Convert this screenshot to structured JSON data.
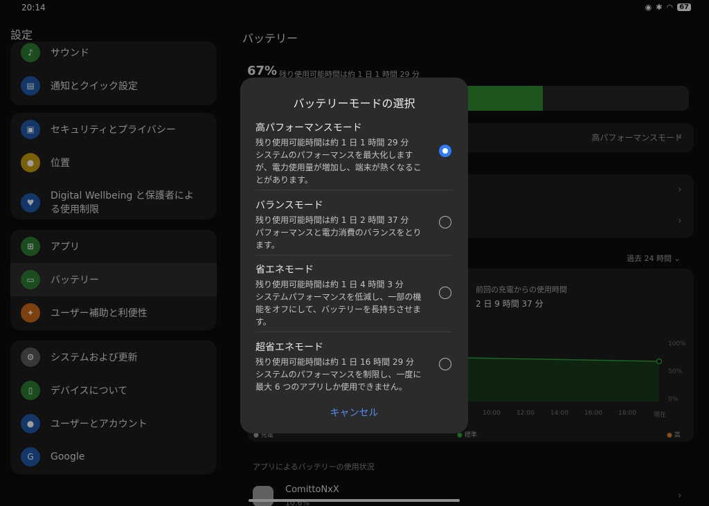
{
  "status": {
    "time": "20:14",
    "battery": "67"
  },
  "left": {
    "title": "設定",
    "group1": [
      {
        "label": "サウンド",
        "icon": "bell-icon"
      },
      {
        "label": "通知とクイック設定",
        "icon": "notification-icon"
      }
    ],
    "group2": [
      {
        "label": "セキュリティとプライバシー",
        "icon": "lock-icon"
      },
      {
        "label": "位置",
        "icon": "location-icon"
      },
      {
        "label": "Digital Wellbeing と保護者による使用制限",
        "icon": "wellbeing-icon"
      }
    ],
    "group3": [
      {
        "label": "アプリ",
        "icon": "apps-icon"
      },
      {
        "label": "バッテリー",
        "icon": "battery-icon"
      },
      {
        "label": "ユーザー補助と利便性",
        "icon": "accessibility-icon"
      }
    ],
    "group4": [
      {
        "label": "システムおよび更新",
        "icon": "gear-icon"
      },
      {
        "label": "デバイスについて",
        "icon": "device-icon"
      },
      {
        "label": "ユーザーとアカウント",
        "icon": "user-icon"
      },
      {
        "label": "Google",
        "icon": "google-icon"
      }
    ]
  },
  "right": {
    "title": "バッテリー",
    "percent": "67%",
    "remaining": "残り使用可能時間は約 1 日 1 時間 29 分",
    "fill_fraction": 0.67,
    "current_mode": "高パフォーマンスモード",
    "period": "過去 24 時間",
    "since_label": "前回の充電からの使用時間",
    "since_value": "2 日 9 時間 37 分",
    "y_ticks": [
      "100%",
      "50%",
      "0%"
    ],
    "x_ticks": [
      "10:00",
      "12:00",
      "14:00",
      "16:00",
      "18:00",
      "現在"
    ],
    "legend": {
      "charge": "充電",
      "standard": "標準",
      "high": "高"
    },
    "apps_label": "アプリによるバッテリーの使用状況",
    "app": {
      "name": "ComittoNxX",
      "pct": "10.6%"
    }
  },
  "dialog": {
    "title": "バッテリーモードの選択",
    "options": [
      {
        "title": "高パフォーマンスモード",
        "time": "残り使用可能時間は約 1 日 1 時間 29 分",
        "desc": "システムのパフォーマンスを最大化しますが、電力使用量が増加し、端末が熱くなることがあります。",
        "selected": true
      },
      {
        "title": "バランスモード",
        "time": "残り使用可能時間は約 1 日 2 時間 37 分",
        "desc": "パフォーマンスと電力消費のバランスをとります。",
        "selected": false
      },
      {
        "title": "省エネモード",
        "time": "残り使用可能時間は約 1 日 4 時間 3 分",
        "desc": "システムパフォーマンスを低減し、一部の機能をオフにして、バッテリーを長持ちさせます。",
        "selected": false
      },
      {
        "title": "超省エネモード",
        "time": "残り使用可能時間は約 1 日 16 時間 29 分",
        "desc": "システムのパフォーマンスを制限し、一度に最大 6 つのアプリしか使用できません。",
        "selected": false
      }
    ],
    "cancel": "キャンセル"
  },
  "colors": {
    "accent": "#2f7cf6",
    "battery": "#2e8b2e",
    "dialog_bg": "#2b2b2b"
  }
}
